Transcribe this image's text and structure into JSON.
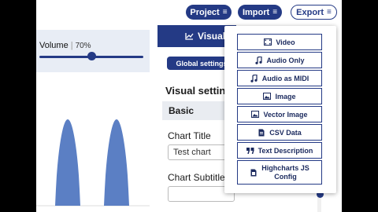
{
  "header": {
    "project_label": "Project",
    "import_label": "Import",
    "export_label": "Export",
    "menu_glyph": "≡"
  },
  "audio": {
    "volume_label": "Volume",
    "separator": "|",
    "volume_value": "70%",
    "volume_fraction": 0.5
  },
  "panel": {
    "visual_tab_label": "Visual",
    "global_settings_label": "Global settings",
    "visual_settings_title": "Visual settings",
    "basic_section_label": "Basic",
    "chart_title_label": "Chart Title",
    "chart_title_value": "Test chart",
    "chart_subtitle_label": "Chart Subtitle",
    "chart_subtitle_value": ""
  },
  "export_menu": {
    "items": [
      {
        "label": "Video",
        "icon": "film-icon"
      },
      {
        "label": "Audio Only",
        "icon": "music-note-icon"
      },
      {
        "label": "Audio as MIDI",
        "icon": "music-notes-icon"
      },
      {
        "label": "Image",
        "icon": "image-icon"
      },
      {
        "label": "Vector Image",
        "icon": "vector-image-icon"
      },
      {
        "label": "CSV Data",
        "icon": "file-csv-icon"
      },
      {
        "label": "Text Description",
        "icon": "quote-icon"
      },
      {
        "label": "Highcharts JS Config",
        "icon": "file-code-icon"
      }
    ]
  },
  "colors": {
    "brand": "#243a85",
    "chart_fill": "#5b7fc4"
  }
}
